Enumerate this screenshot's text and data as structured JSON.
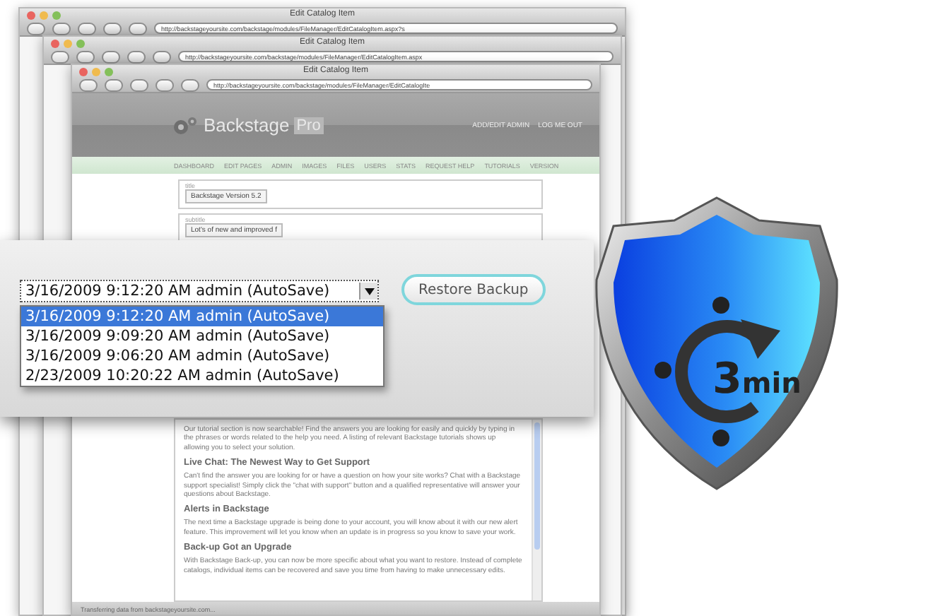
{
  "windows": [
    {
      "title": "Edit Catalog Item",
      "url": "http://backstageyoursite.com/backstage/modules/FileManager/EditCatalogItem.aspx?s"
    },
    {
      "title": "Edit Catalog Item",
      "url": "http://backstageyoursite.com/backstage/modules/FileManager/EditCatalogItem.aspx"
    },
    {
      "title": "Edit Catalog Item",
      "url": "http://backstageyoursite.com/backstage/modules/FileManager/EditCatalogIte"
    }
  ],
  "page": {
    "logo": {
      "name": "Backstage",
      "badge": "Pro"
    },
    "header_links": [
      "ADD/EDIT ADMIN",
      "LOG ME OUT"
    ],
    "nav": [
      "DASHBOARD",
      "EDIT PAGES",
      "ADMIN",
      "IMAGES",
      "FILES",
      "USERS",
      "STATS",
      "REQUEST HELP",
      "TUTORIALS",
      "VERSION"
    ],
    "fields": [
      {
        "label": "title",
        "value": "Backstage Version 5.2"
      },
      {
        "label": "subtitle",
        "value": "Lot's of new and improved f"
      }
    ],
    "article": [
      {
        "kind": "paragraph",
        "text": "Our tutorial section is now searchable! Find the answers you are looking for easily and quickly by typing in the phrases or words related to the help you need. A listing of relevant Backstage tutorials shows up allowing you to select your solution."
      },
      {
        "kind": "heading",
        "text": "Live Chat: The Newest Way to Get Support"
      },
      {
        "kind": "paragraph",
        "text": "Can't find the answer you are looking for or have a question on how your site works? Chat with a Backstage support specialist! Simply click the \"chat with support\" button and a qualified representative will answer your questions about Backstage."
      },
      {
        "kind": "heading",
        "text": "Alerts in Backstage"
      },
      {
        "kind": "paragraph",
        "text": "The next time a Backstage upgrade is being done to your account, you will know about it with our new alert feature. This improvement will let you know when an update is in progress so you know to save your work."
      },
      {
        "kind": "heading",
        "text": "Back-up Got an Upgrade"
      },
      {
        "kind": "paragraph",
        "text": "With Backstage Back-up, you can now be more specific about what you want to restore. Instead of complete catalogs, individual items can be recovered and save you time from having to make unnecessary edits."
      }
    ],
    "status_bar": "Transferring data from backstageyoursite.com..."
  },
  "backup": {
    "value": "3/16/2009 9:12:20 AM admin (AutoSave)",
    "options": [
      {
        "label": "3/16/2009 9:12:20 AM admin (AutoSave)",
        "selected": true
      },
      {
        "label": "3/16/2009 9:09:20 AM admin (AutoSave)",
        "selected": false
      },
      {
        "label": "3/16/2009 9:06:20 AM admin (AutoSave)",
        "selected": false
      },
      {
        "label": "2/23/2009 10:20:22 AM admin (AutoSave)",
        "selected": false
      }
    ],
    "button": "Restore Backup"
  },
  "shield": {
    "value": "3",
    "unit": "min"
  }
}
